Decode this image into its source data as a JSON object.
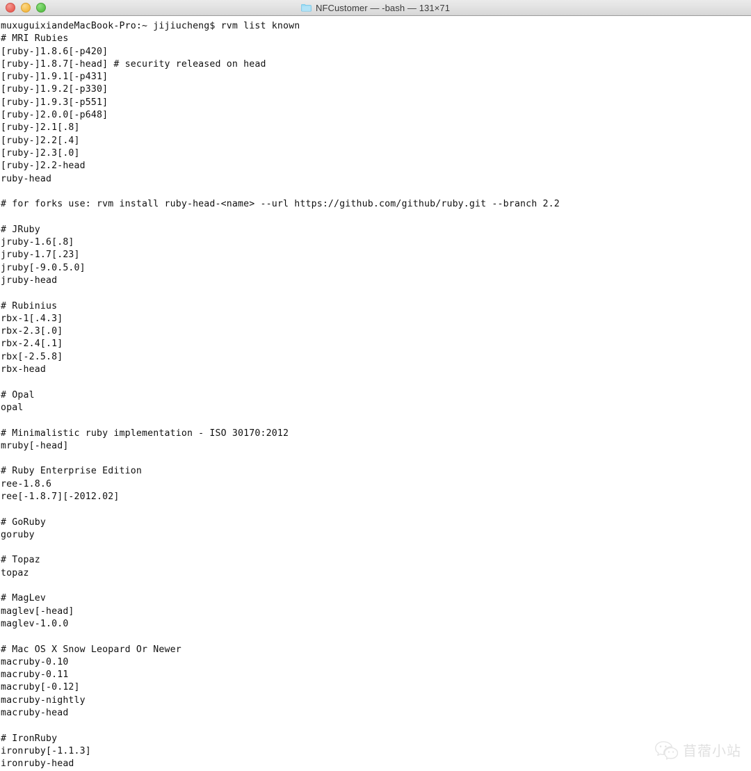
{
  "window": {
    "title_full": "NFCustomer — -bash — 131×71",
    "title_session": "NFCustomer",
    "title_shell": "-bash",
    "title_size": "131×71",
    "folder_icon": "folder-icon",
    "controls": {
      "close": "close-button",
      "minimize": "minimize-button",
      "maximize": "maximize-button"
    },
    "colors": {
      "close": "#ea6157",
      "minimize": "#f4ba45",
      "maximize": "#5bc24a",
      "titlebar_top": "#ebebeb",
      "titlebar_bottom": "#d6d6d6",
      "folder": "#8fd4f0",
      "terminal_bg": "#ffffff",
      "terminal_fg": "#101010"
    }
  },
  "terminal": {
    "prompt_host": "muxuguixiandeMacBook-Pro",
    "prompt_path": "~",
    "prompt_user": "jijiucheng",
    "command": "rvm list known",
    "lines": [
      "muxuguixiandeMacBook-Pro:~ jijiucheng$ rvm list known",
      "# MRI Rubies",
      "[ruby-]1.8.6[-p420]",
      "[ruby-]1.8.7[-head] # security released on head",
      "[ruby-]1.9.1[-p431]",
      "[ruby-]1.9.2[-p330]",
      "[ruby-]1.9.3[-p551]",
      "[ruby-]2.0.0[-p648]",
      "[ruby-]2.1[.8]",
      "[ruby-]2.2[.4]",
      "[ruby-]2.3[.0]",
      "[ruby-]2.2-head",
      "ruby-head",
      "",
      "# for forks use: rvm install ruby-head-<name> --url https://github.com/github/ruby.git --branch 2.2",
      "",
      "# JRuby",
      "jruby-1.6[.8]",
      "jruby-1.7[.23]",
      "jruby[-9.0.5.0]",
      "jruby-head",
      "",
      "# Rubinius",
      "rbx-1[.4.3]",
      "rbx-2.3[.0]",
      "rbx-2.4[.1]",
      "rbx[-2.5.8]",
      "rbx-head",
      "",
      "# Opal",
      "opal",
      "",
      "# Minimalistic ruby implementation - ISO 30170:2012",
      "mruby[-head]",
      "",
      "# Ruby Enterprise Edition",
      "ree-1.8.6",
      "ree[-1.8.7][-2012.02]",
      "",
      "# GoRuby",
      "goruby",
      "",
      "# Topaz",
      "topaz",
      "",
      "# MagLev",
      "maglev[-head]",
      "maglev-1.0.0",
      "",
      "# Mac OS X Snow Leopard Or Newer",
      "macruby-0.10",
      "macruby-0.11",
      "macruby[-0.12]",
      "macruby-nightly",
      "macruby-head",
      "",
      "# IronRuby",
      "ironruby[-1.1.3]",
      "ironruby-head"
    ]
  },
  "watermark": {
    "icon": "wechat-icon",
    "text": "苜蓿小站"
  }
}
